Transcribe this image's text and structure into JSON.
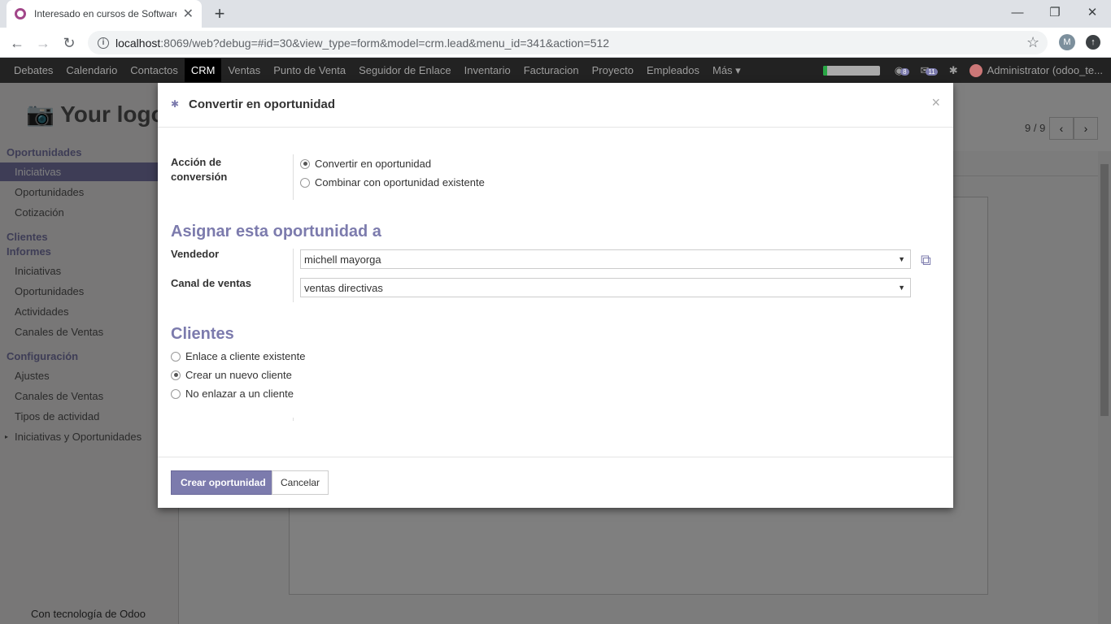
{
  "browser": {
    "tab_title": "Interesado en cursos de Software",
    "url_host": "localhost",
    "url_rest": ":8069/web?debug=#id=30&view_type=form&model=crm.lead&menu_id=341&action=512",
    "profile_initial": "M"
  },
  "topmenu": {
    "items": [
      "Debates",
      "Calendario",
      "Contactos",
      "CRM",
      "Ventas",
      "Punto de Venta",
      "Seguidor de Enlace",
      "Inventario",
      "Facturacion",
      "Proyecto",
      "Empleados",
      "Más"
    ],
    "active": "CRM",
    "chat_count": "8",
    "msg_count": "11",
    "user": "Administrator (odoo_te...",
    "progress": 0.08
  },
  "sidebar": {
    "logo": "Your logo",
    "sections": [
      {
        "title": "Oportunidades",
        "items": [
          "Iniciativas",
          "Oportunidades",
          "Cotización"
        ]
      },
      {
        "title": "Clientes",
        "items": []
      },
      {
        "title": "Informes",
        "items": [
          "Iniciativas",
          "Oportunidades",
          "Actividades",
          "Canales de Ventas"
        ]
      },
      {
        "title": "Configuración",
        "items": [
          "Ajustes",
          "Canales de Ventas",
          "Tipos de actividad",
          "Iniciativas y Oportunidades"
        ]
      }
    ],
    "footer": "Con tecnología de Odoo"
  },
  "pager": {
    "text": "9 / 9"
  },
  "modal": {
    "title": "Convertir en oportunidad",
    "conversion_label": "Acción de conversión",
    "conversion_options": [
      "Convertir en oportunidad",
      "Combinar con oportunidad existente"
    ],
    "assign_title": "Asignar esta oportunidad a",
    "vendedor_label": "Vendedor",
    "vendedor_value": "michell mayorga",
    "canal_label": "Canal de ventas",
    "canal_value": "ventas directivas",
    "clientes_title": "Clientes",
    "client_options": [
      "Enlace a cliente existente",
      "Crear un nuevo cliente",
      "No enlazar a un cliente"
    ],
    "create_button": "Crear oportunidad",
    "cancel_button": "Cancelar"
  }
}
